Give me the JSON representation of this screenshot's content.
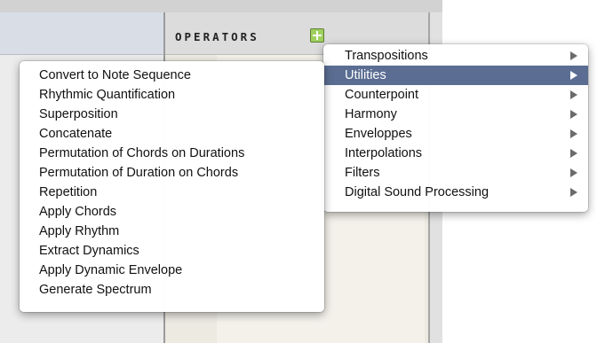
{
  "operators_panel": {
    "title": "OPERATORS"
  },
  "colors": {
    "menu_highlight": "#5b6d92",
    "add_button": "#9fd05e"
  },
  "icons": {
    "add_button": "plus-icon",
    "submenu_arrow": "chevron-right-icon"
  },
  "category_menu": {
    "selected": "Utilities",
    "items": [
      {
        "label": "Transpositions"
      },
      {
        "label": "Utilities"
      },
      {
        "label": "Counterpoint"
      },
      {
        "label": "Harmony"
      },
      {
        "label": "Enveloppes"
      },
      {
        "label": "Interpolations"
      },
      {
        "label": "Filters"
      },
      {
        "label": "Digital Sound Processing"
      }
    ]
  },
  "utilities_menu": {
    "items": [
      {
        "label": "Convert to Note Sequence"
      },
      {
        "label": "Rhythmic Quantification"
      },
      {
        "label": "Superposition"
      },
      {
        "label": "Concatenate"
      },
      {
        "label": "Permutation of Chords on Durations"
      },
      {
        "label": "Permutation of Duration on Chords"
      },
      {
        "label": "Repetition"
      },
      {
        "label": "Apply Chords"
      },
      {
        "label": "Apply Rhythm"
      },
      {
        "label": "Extract Dynamics"
      },
      {
        "label": "Apply Dynamic Envelope"
      },
      {
        "label": "Generate Spectrum"
      }
    ]
  }
}
